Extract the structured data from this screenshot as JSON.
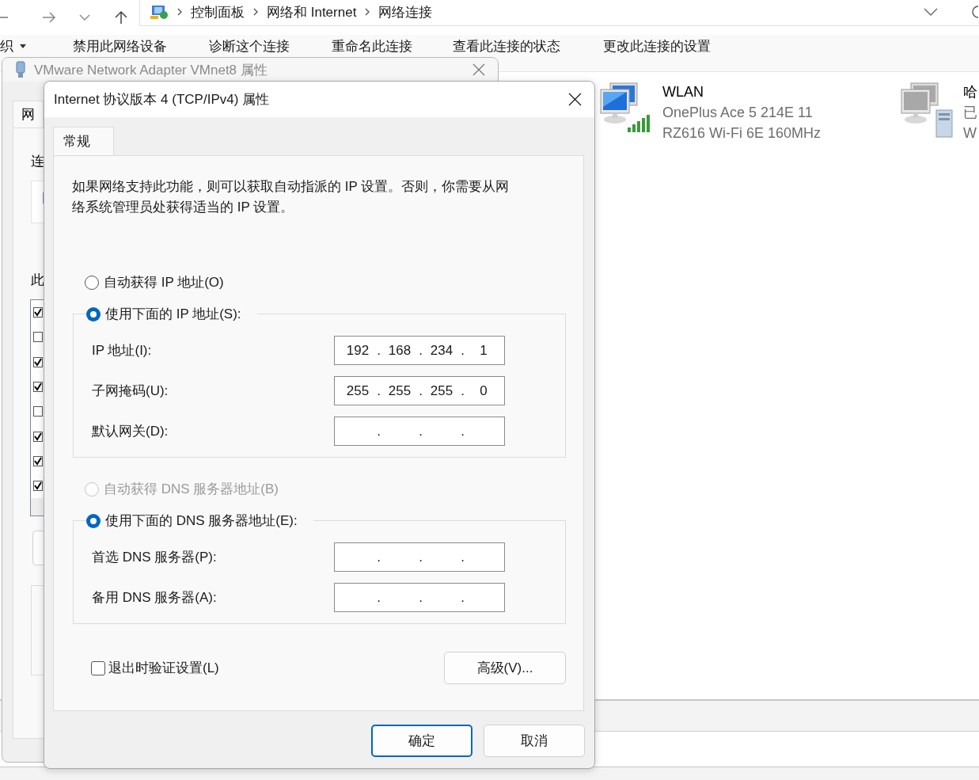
{
  "explorer": {
    "breadcrumb": [
      {
        "label": "控制面板"
      },
      {
        "label": "网络和 Internet"
      },
      {
        "label": "网络连接"
      }
    ],
    "toolbar": [
      {
        "label": "织",
        "kind": "menu"
      },
      {
        "label": "禁用此网络设备",
        "kind": "command"
      },
      {
        "label": "诊断这个连接",
        "kind": "command"
      },
      {
        "label": "重命名此连接",
        "kind": "command"
      },
      {
        "label": "查看此连接的状态",
        "kind": "command"
      },
      {
        "label": "更改此连接的设置",
        "kind": "command"
      }
    ],
    "connections": [
      {
        "kind": "wifi",
        "name": "WLAN",
        "lines": [
          "OnePlus Ace 5 214E 11",
          "RZ616 Wi-Fi 6E 160MHz"
        ]
      },
      {
        "kind": "wired",
        "name": "哈",
        "lines": [
          "已",
          "W"
        ]
      }
    ]
  },
  "vm_dialog": {
    "title": "VMware Network Adapter VMnet8 属性",
    "tab": "网",
    "labels": [
      "连",
      "此"
    ],
    "components": [
      {
        "checked": true
      },
      {
        "checked": false
      },
      {
        "checked": true
      },
      {
        "checked": true
      },
      {
        "checked": false
      },
      {
        "checked": true
      },
      {
        "checked": true
      },
      {
        "checked": true
      }
    ]
  },
  "tcp_dialog": {
    "title": "Internet 协议版本 4 (TCP/IPv4) 属性",
    "tabs": [
      {
        "label": "常规",
        "selected": true
      }
    ],
    "description": "如果网络支持此功能，则可以获取自动指派的 IP 设置。否则，你需要从网络系统管理员处获得适当的 IP 设置。",
    "ip_options": [
      {
        "label": "自动获得 IP 地址(O)",
        "selected": false,
        "disabled": false
      },
      {
        "label": "使用下面的 IP 地址(S):",
        "selected": true,
        "disabled": false
      }
    ],
    "ip_fields": [
      {
        "label": "IP 地址(I):",
        "octets": [
          "192",
          "168",
          "234",
          "1"
        ],
        "dots": [
          ".",
          ".",
          "."
        ]
      },
      {
        "label": "子网掩码(U):",
        "octets": [
          "255",
          "255",
          "255",
          "0"
        ],
        "dots": [
          ".",
          ".",
          "."
        ]
      },
      {
        "label": "默认网关(D):",
        "dots": [
          ".",
          ".",
          "."
        ]
      }
    ],
    "dns_options": [
      {
        "label": "自动获得 DNS 服务器地址(B)",
        "selected": false,
        "disabled": true
      },
      {
        "label": "使用下面的 DNS 服务器地址(E):",
        "selected": true,
        "disabled": false
      }
    ],
    "dns_fields": [
      {
        "label": "首选 DNS 服务器(P):",
        "dots": [
          ".",
          ".",
          "."
        ]
      },
      {
        "label": "备用 DNS 服务器(A):",
        "dots": [
          ".",
          ".",
          "."
        ]
      }
    ],
    "validate_checkbox": {
      "label": "退出时验证设置(L)",
      "checked": false
    },
    "advanced_button": "高级(V)...",
    "buttons": [
      {
        "label": "确定",
        "default": true
      },
      {
        "label": "取消",
        "default": false
      }
    ]
  }
}
